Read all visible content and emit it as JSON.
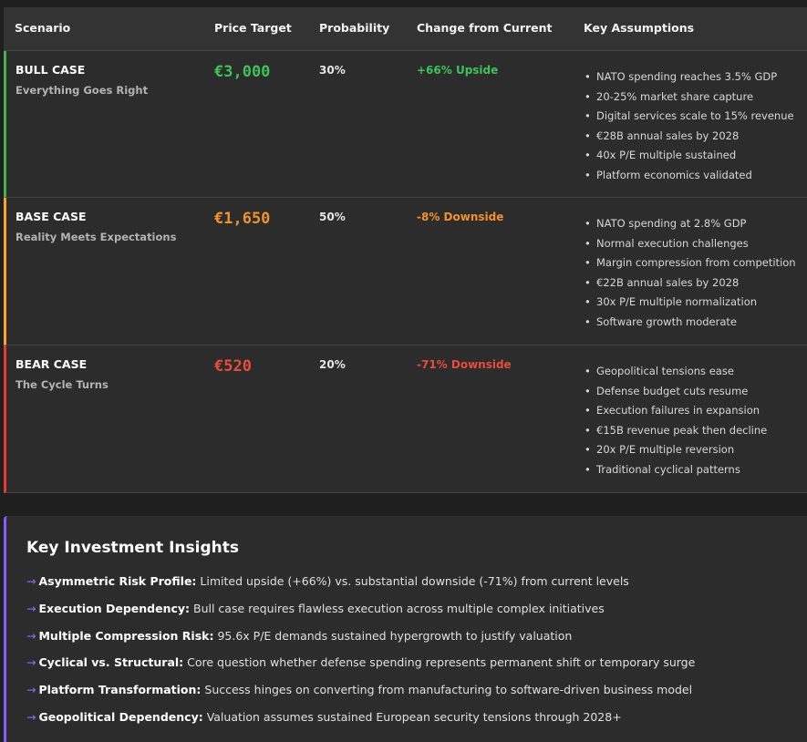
{
  "table": {
    "headers": [
      "Scenario",
      "Price Target",
      "Probability",
      "Change from Current",
      "Key Assumptions"
    ],
    "rows": [
      {
        "title": "BULL CASE",
        "subtitle": "Everything Goes Right",
        "price": "€3,000",
        "probability": "30%",
        "change": "+66% Upside",
        "assumptions": [
          "NATO spending reaches 3.5% GDP",
          "20-25% market share capture",
          "Digital services scale to 15% revenue",
          "€28B annual sales by 2028",
          "40x P/E multiple sustained",
          "Platform economics validated"
        ]
      },
      {
        "title": "BASE CASE",
        "subtitle": "Reality Meets Expectations",
        "price": "€1,650",
        "probability": "50%",
        "change": "-8% Downside",
        "assumptions": [
          "NATO spending at 2.8% GDP",
          "Normal execution challenges",
          "Margin compression from competition",
          "€22B annual sales by 2028",
          "30x P/E multiple normalization",
          "Software growth moderate"
        ]
      },
      {
        "title": "BEAR CASE",
        "subtitle": "The Cycle Turns",
        "price": "€520",
        "probability": "20%",
        "change": "-71% Downside",
        "assumptions": [
          "Geopolitical tensions ease",
          "Defense budget cuts resume",
          "Execution failures in expansion",
          "€15B revenue peak then decline",
          "20x P/E multiple reversion",
          "Traditional cyclical patterns"
        ]
      }
    ]
  },
  "insights": {
    "title": "Key Investment Insights",
    "arrow": "→",
    "items": [
      {
        "head": "Asymmetric Risk Profile:",
        "text": " Limited upside (+66%) vs. substantial downside (-71%) from current levels"
      },
      {
        "head": "Execution Dependency:",
        "text": " Bull case requires flawless execution across multiple complex initiatives"
      },
      {
        "head": "Multiple Compression Risk:",
        "text": " 95.6x P/E demands sustained hypergrowth to justify valuation"
      },
      {
        "head": "Cyclical vs. Structural:",
        "text": " Core question whether defense spending represents permanent shift or temporary surge"
      },
      {
        "head": "Platform Transformation:",
        "text": " Success hinges on converting from manufacturing to software-driven business model"
      },
      {
        "head": "Geopolitical Dependency:",
        "text": " Valuation assumes sustained European security tensions through 2028+"
      }
    ]
  },
  "colors": {
    "bull": "#3ec25a",
    "base": "#f0932b",
    "bear": "#e74c3c",
    "accent": "#8a5cf6"
  }
}
